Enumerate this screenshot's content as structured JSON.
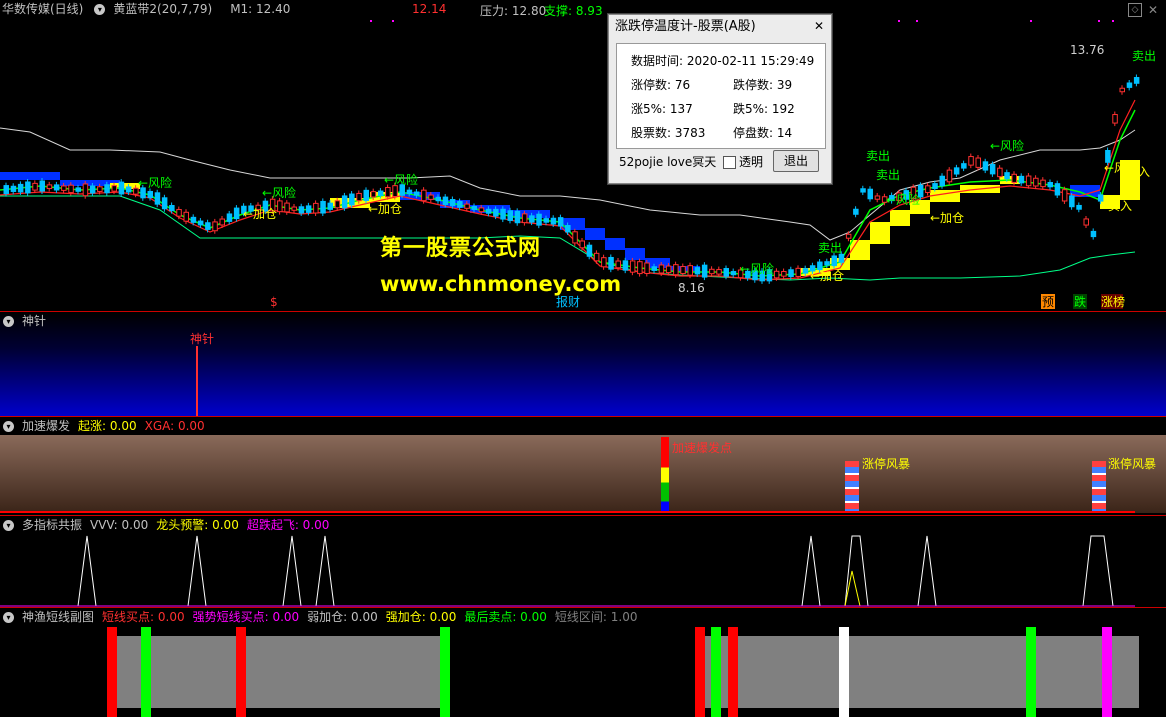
{
  "colors": {
    "up": "#ff3030",
    "down": "#00c0ff",
    "yellow": "#ffff00",
    "green": "#00ff00",
    "magenta": "#ff00ff",
    "gray": "#808080",
    "white": "#ffffff"
  },
  "main": {
    "stock_name": "华数传媒(日线)",
    "indicator": "黄蓝带2(20,7,79)",
    "m1": "M1: 12.40",
    "price_red": "12.14",
    "pressure": "压力: 12.80",
    "support": "支撑: 8.93",
    "high_label": "13.76",
    "low_label": "8.16",
    "annotations": [
      "←风险",
      "←加仓",
      "←风险",
      "←加仓",
      "←风险",
      "←风险",
      "←风险",
      "←加仓",
      "卖出",
      "卖出",
      "←风险",
      "←加仓",
      "卖出",
      "←风险",
      "卖出",
      "买入",
      "买入"
    ],
    "bottom_tags": [
      "预",
      "跌",
      "涨榜"
    ],
    "left_tag": "$",
    "mid_tag": "报财"
  },
  "watermark": {
    "line1": "第一股票公式网",
    "line2": "www.chnmoney.com"
  },
  "dialog": {
    "title": "涨跌停温度计-股票(A股)",
    "time_label": "数据时间: 2020-02-11 15:29:49",
    "limit_up": "涨停数: 76",
    "limit_down": "跌停数: 39",
    "up5": "涨5%: 137",
    "down5": "跌5%: 192",
    "stocks": "股票数: 3783",
    "suspended": "停盘数: 14",
    "footer": "52pojie love冥天",
    "transparent": "透明",
    "exit": "退出"
  },
  "pane2": {
    "title": "神针",
    "mark": "神针"
  },
  "pane3": {
    "title": "加速爆发",
    "v1": "起涨: 0.00",
    "v2": "XGA: 0.00",
    "mark1": "加速爆发点",
    "mark2": "涨停风暴",
    "mark3": "涨停风暴"
  },
  "pane4": {
    "title": "多指标共振",
    "v1": "VVV: 0.00",
    "v2": "龙头预警: 0.00",
    "v3": "超跌起飞: 0.00"
  },
  "pane5": {
    "title": "神渔短线副图",
    "v1": "短线买点: 0.00",
    "v2": "强势短线买点: 0.00",
    "v3": "弱加仓: 0.00",
    "v4": "强加仓: 0.00",
    "v5": "最后卖点: 0.00",
    "v6": "短线区间: 1.00"
  }
}
